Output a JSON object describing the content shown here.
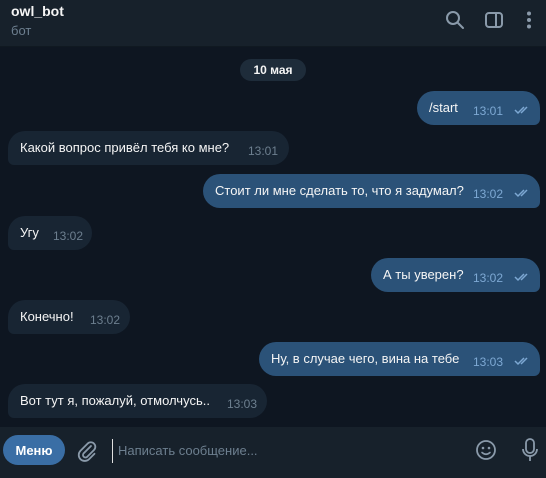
{
  "header": {
    "title": "owl_bot",
    "subtitle": "бот"
  },
  "date": "10 мая",
  "messages": [
    {
      "dir": "out",
      "text": "/start",
      "time": "13:01"
    },
    {
      "dir": "in",
      "text": "Какой вопрос привёл тебя ко мне?",
      "time": "13:01"
    },
    {
      "dir": "out",
      "text": "Стоит ли мне сделать то, что я задумал?",
      "time": "13:02"
    },
    {
      "dir": "in",
      "text": "Угу",
      "time": "13:02"
    },
    {
      "dir": "out",
      "text": "А ты уверен?",
      "time": "13:02"
    },
    {
      "dir": "in",
      "text": "Конечно!",
      "time": "13:02"
    },
    {
      "dir": "out",
      "text": "Ну, в случае чего, вина на тебе",
      "time": "13:03"
    },
    {
      "dir": "in",
      "text": "Вот тут я, пожалуй, отмолчусь..",
      "time": "13:03"
    }
  ],
  "composer": {
    "menu_label": "Меню",
    "placeholder": "Написать сообщение..."
  },
  "colors": {
    "background": "#0e1621",
    "header": "#17212b",
    "incoming_bubble": "#182533",
    "outgoing_bubble": "#2b5278",
    "menu_button": "#3a6ea5"
  }
}
